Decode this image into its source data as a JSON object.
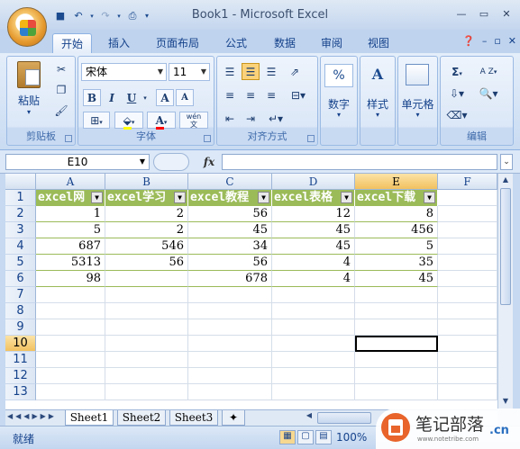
{
  "window": {
    "title": "Book1 - Microsoft Excel"
  },
  "tabs": [
    "开始",
    "插入",
    "页面布局",
    "公式",
    "数据",
    "审阅",
    "视图"
  ],
  "ribbon": {
    "paste_label": "粘贴",
    "font_name": "宋体",
    "font_size": "11",
    "bold": "B",
    "italic": "I",
    "underline": "U",
    "font_grow": "A",
    "font_shrink": "A",
    "font_color": "A",
    "wen": "wén\n文",
    "groups": {
      "clipboard": "剪贴板",
      "font": "字体",
      "alignment": "对齐方式",
      "editing": "编辑"
    },
    "number_label": "数字",
    "number_icon": "%",
    "styles_label": "样式",
    "styles_icon": "A",
    "cells_label": "单元格",
    "sum_icon": "Σ",
    "sort_icon": "A Z"
  },
  "formula_bar": {
    "name_box": "E10",
    "fx": "fx",
    "value": ""
  },
  "sheet": {
    "columns": [
      "A",
      "B",
      "C",
      "D",
      "E",
      "F"
    ],
    "rows": [
      "1",
      "2",
      "3",
      "4",
      "5",
      "6",
      "7",
      "8",
      "9",
      "10",
      "11",
      "12",
      "13"
    ],
    "selected_column": "E",
    "selected_row": "10",
    "header_row": [
      "excel网",
      "excel学习",
      "excel教程",
      "excel表格",
      "excel下载"
    ],
    "data": [
      [
        "1",
        "2",
        "56",
        "12",
        "8"
      ],
      [
        "5",
        "2",
        "45",
        "45",
        "456"
      ],
      [
        "687",
        "546",
        "34",
        "45",
        "5"
      ],
      [
        "5313",
        "56",
        "56",
        "4",
        "35"
      ],
      [
        "98",
        "",
        "678",
        "4",
        "45"
      ]
    ]
  },
  "sheet_tabs": [
    "Sheet1",
    "Sheet2",
    "Sheet3"
  ],
  "status": {
    "ready": "就绪",
    "zoom": "100%"
  },
  "watermark": {
    "cn": "笔记部落",
    "url": "www.notetribe.com",
    "cn_suffix": ".cn"
  },
  "colors": {
    "header_fill": "#9bbb59",
    "selection": "#f2c15f",
    "ribbon": "#dbe7f7"
  }
}
